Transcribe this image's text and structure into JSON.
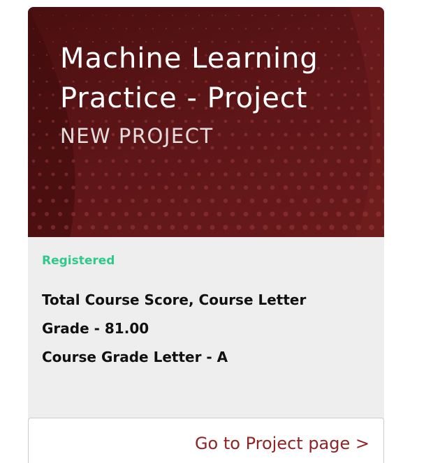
{
  "card": {
    "title": "Machine Learning Practice - Project",
    "subtitle": "NEW PROJECT",
    "status": "Registered",
    "grade_lines": [
      "Total Course Score, Course Letter",
      "Grade - 81.00",
      "Course Grade Letter - A"
    ],
    "link_label": "Go to Project page >"
  },
  "colors": {
    "hero_bg": "#5c1517",
    "status": "#2fc98b",
    "link": "#8f2424",
    "body_bg": "#eeeeee"
  }
}
